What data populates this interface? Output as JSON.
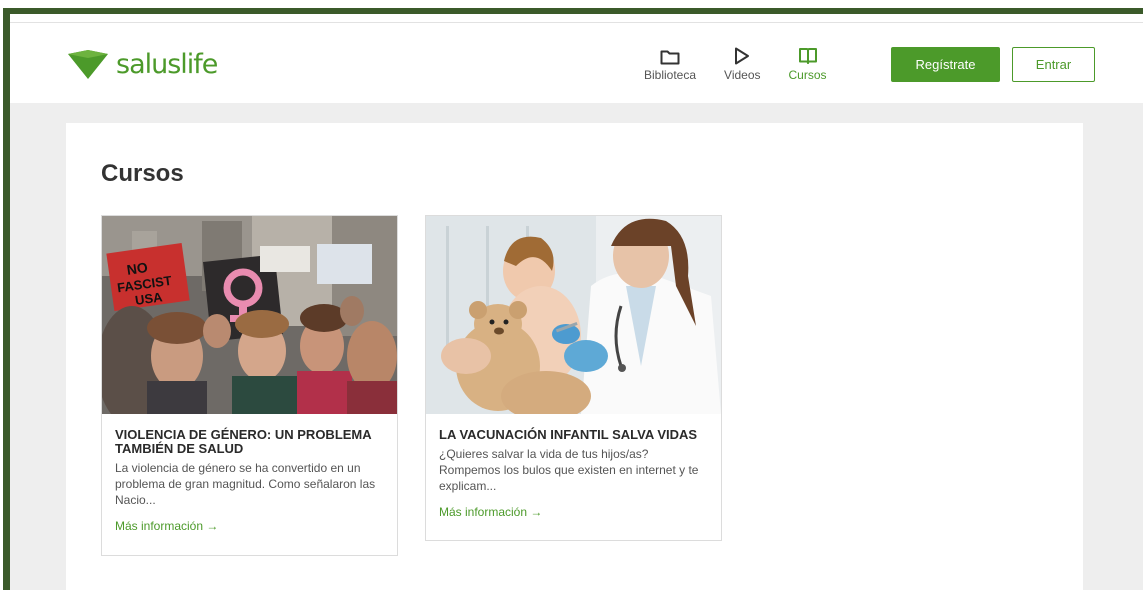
{
  "brand": {
    "name": "saluslife",
    "accent": "#4c9a2a",
    "frame": "#3b5a2a"
  },
  "nav": {
    "items": [
      {
        "label": "Biblioteca",
        "icon": "folder-icon",
        "active": false
      },
      {
        "label": "Videos",
        "icon": "play-icon",
        "active": false
      },
      {
        "label": "Cursos",
        "icon": "book-icon",
        "active": true
      }
    ]
  },
  "header": {
    "register_label": "Regístrate",
    "login_label": "Entrar"
  },
  "main": {
    "title": "Cursos",
    "cards": [
      {
        "title": "VIOLENCIA DE GÉNERO: UN PROBLEMA TAMBIÉN DE SALUD",
        "description": "La violencia de género se ha convertido en un problema de gran magnitud. Como señalaron las Nacio...",
        "link": "Más información →",
        "image": "protest-photo",
        "image_signs": [
          "NO",
          "FASCIST",
          "USA"
        ]
      },
      {
        "title": "LA VACUNACIÓN INFANTIL SALVA VIDAS",
        "description": "¿Quieres salvar la vida de tus hijos/as? Rompemos los bulos que existen en internet y te explicam...",
        "link": "Más información →",
        "image": "vaccination-photo"
      }
    ]
  }
}
